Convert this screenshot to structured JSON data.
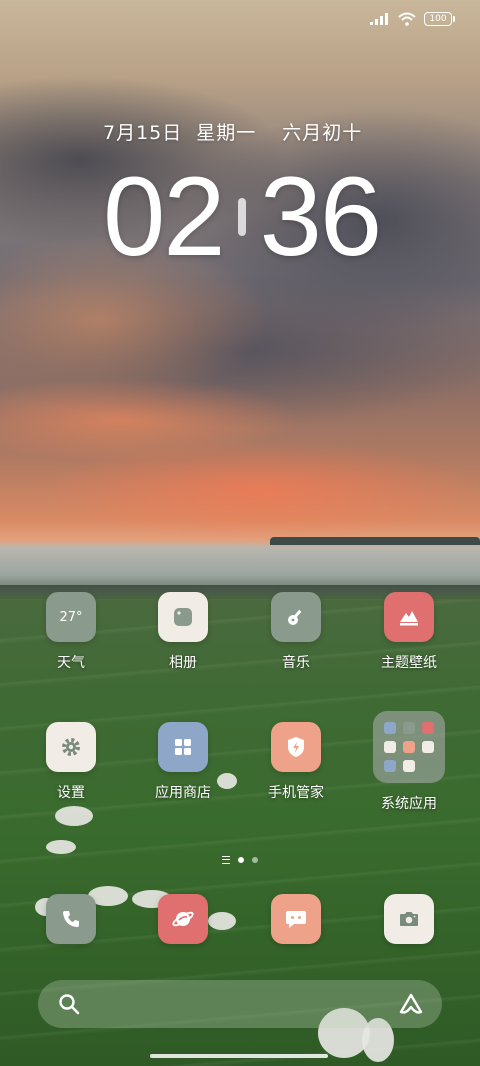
{
  "status_bar": {
    "battery_level": "100",
    "signal_icon": "signal-bars-icon",
    "wifi_icon": "wifi-icon"
  },
  "widget": {
    "date": "7月15日",
    "weekday": "星期一",
    "lunar_date": "六月初十",
    "hour": "02",
    "minute": "36"
  },
  "apps_row1": [
    {
      "label": "天气",
      "tile_text": "27°",
      "color": "#8a9a8c"
    },
    {
      "label": "相册",
      "color": "#f1ede6"
    },
    {
      "label": "音乐",
      "color": "#8a9a8c"
    },
    {
      "label": "主题壁纸",
      "color": "#e07070"
    }
  ],
  "apps_row2": [
    {
      "label": "设置",
      "color": "#f1ede6"
    },
    {
      "label": "应用商店",
      "color": "#8ea7c8"
    },
    {
      "label": "手机管家",
      "color": "#eea28a"
    },
    {
      "label": "系统应用",
      "color": "#96a096"
    }
  ],
  "dock": [
    {
      "name": "phone",
      "color": "#8a9a8c"
    },
    {
      "name": "browser",
      "color": "#e07070"
    },
    {
      "name": "messages",
      "color": "#eea28a"
    },
    {
      "name": "camera",
      "color": "#f1ede6"
    }
  ],
  "page_indicator": {
    "pages": 2,
    "active": 1
  }
}
